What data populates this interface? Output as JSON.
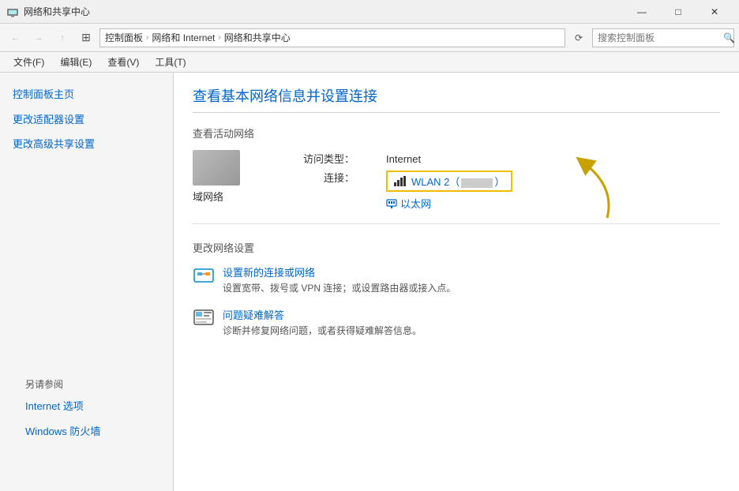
{
  "titleBar": {
    "title": "网络和共享中心",
    "minBtn": "—",
    "maxBtn": "□",
    "closeBtn": "✕"
  },
  "addressBar": {
    "backBtn": "←",
    "forwardBtn": "→",
    "upBtn": "↑",
    "breadcrumb": [
      {
        "label": "控制面板"
      },
      {
        "label": "网络和 Internet"
      },
      {
        "label": "网络和共享中心"
      }
    ],
    "refreshBtn": "⟳",
    "searchPlaceholder": "搜索控制面板",
    "searchIcon": "🔍"
  },
  "menuBar": {
    "items": [
      {
        "label": "文件(F)"
      },
      {
        "label": "编辑(E)"
      },
      {
        "label": "查看(V)"
      },
      {
        "label": "工具(T)"
      }
    ]
  },
  "sidebar": {
    "items": [
      {
        "label": "控制面板主页"
      },
      {
        "label": "更改适配器设置"
      },
      {
        "label": "更改高级共享设置"
      }
    ],
    "alsoSection": "另请参阅",
    "alsoItems": [
      {
        "label": "Internet 选项"
      },
      {
        "label": "Windows 防火墙"
      }
    ]
  },
  "content": {
    "title": "查看基本网络信息并设置连接",
    "activeNetworkHeader": "查看活动网络",
    "networkName": "域网络",
    "accessTypeLabel": "访问类型：",
    "connectionLabel": "连接：",
    "accessTypeValue": "Internet",
    "wlanLabel": "WLAN 2（",
    "wlanSuffix": "）",
    "ethernetLabel": "以太网",
    "settingsHeader": "更改网络设置",
    "settings": [
      {
        "link": "设置新的连接或网络",
        "desc": "设置宽带、拨号或 VPN 连接；或设置路由器或接入点。"
      },
      {
        "link": "问题疑难解答",
        "desc": "诊断并修复网络问题，或者获得疑难解答信息。"
      }
    ]
  }
}
